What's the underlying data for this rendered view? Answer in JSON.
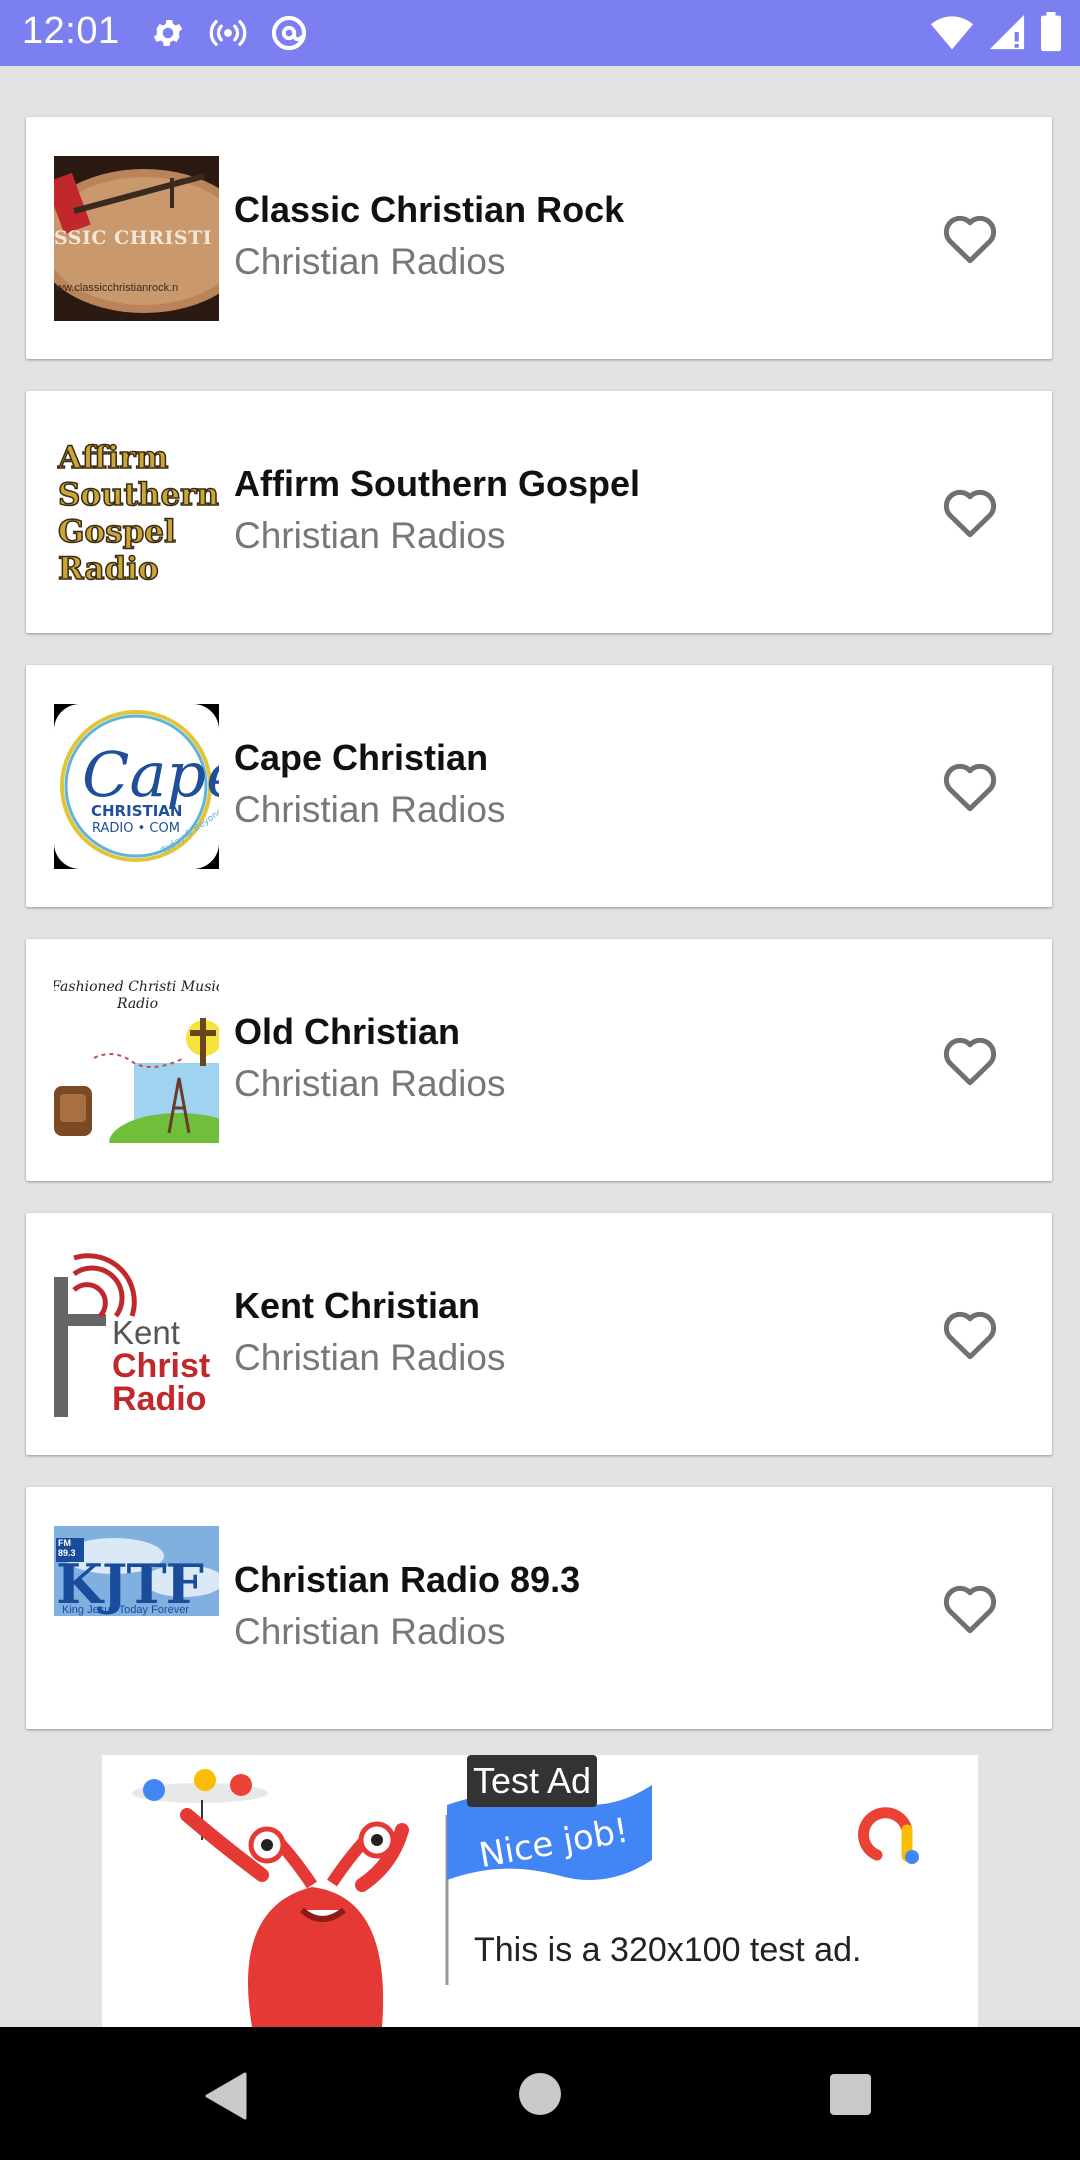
{
  "status_bar": {
    "time": "12:01",
    "left_icons": [
      "gear-icon",
      "broadcast-icon",
      "at-sign-icon"
    ],
    "right_icons": [
      "wifi-icon",
      "signal-icon",
      "battery-icon"
    ],
    "background": "#7b7ff0"
  },
  "stations": [
    {
      "title": "Classic Christian Rock",
      "subtitle": "Christian Radios",
      "logo": "classic-christian-rock-logo",
      "logo_text": "SSIC CHRISTI ROCK RADIO"
    },
    {
      "title": "Affirm Southern Gospel",
      "subtitle": "Christian Radios",
      "logo": "affirm-southern-gospel-logo",
      "logo_text": "Affirm Southern Gospel Radio"
    },
    {
      "title": "Cape Christian",
      "subtitle": "Christian Radios",
      "logo": "cape-christian-logo",
      "logo_text": "Cape CHRISTIAN RADIO COM"
    },
    {
      "title": "Old Christian",
      "subtitle": "Christian Radios",
      "logo": "old-christian-logo",
      "logo_text": "Fashioned Christi Music Radio"
    },
    {
      "title": "Kent Christian",
      "subtitle": "Christian Radios",
      "logo": "kent-christian-logo",
      "logo_text": "Kent Christ Radio"
    },
    {
      "title": "Christian Radio 89.3",
      "subtitle": "Christian Radios",
      "logo": "kjtf-logo",
      "logo_text": "KJTF"
    }
  ],
  "ad": {
    "tag": "Test Ad",
    "banner_text": "Nice job!",
    "body_text": "This is a 320x100 test ad."
  },
  "nav_bar": {
    "icons": [
      "back-icon",
      "home-icon",
      "recents-icon"
    ]
  }
}
